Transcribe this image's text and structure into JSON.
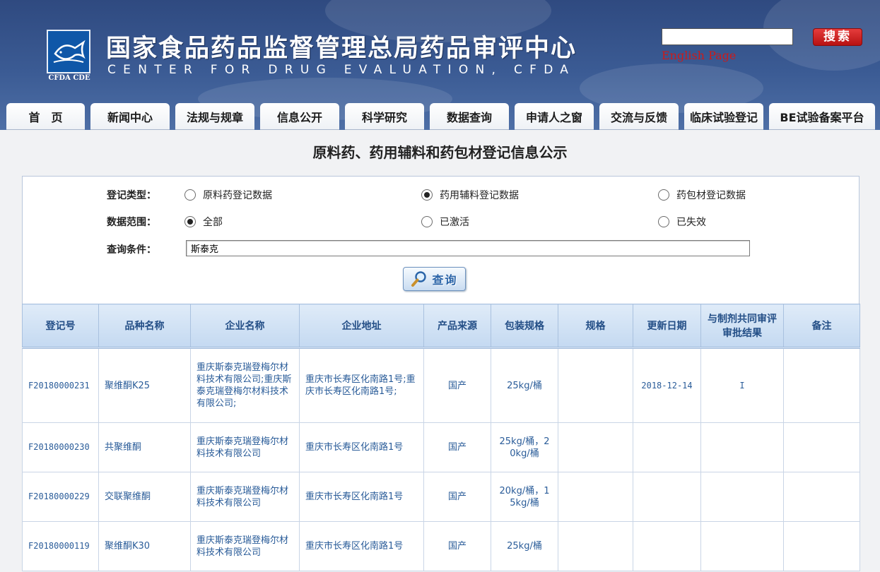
{
  "header": {
    "logo_caption": "CFDA CDE",
    "title": "国家食品药品监督管理总局药品审评中心",
    "subtitle": "CENTER FOR DRUG EVALUATION, CFDA",
    "search_value": "",
    "search_button": "搜索",
    "english_link": "English Page"
  },
  "nav": {
    "tabs": [
      {
        "label": "首　页"
      },
      {
        "label": "新闻中心"
      },
      {
        "label": "法规与规章"
      },
      {
        "label": "信息公开"
      },
      {
        "label": "科学研究"
      },
      {
        "label": "数据查询"
      },
      {
        "label": "申请人之窗"
      },
      {
        "label": "交流与反馈"
      },
      {
        "label": "临床试验登记"
      },
      {
        "label": "BE试验备案平台"
      }
    ]
  },
  "page": {
    "title": "原料药、药用辅料和药包材登记信息公示"
  },
  "form": {
    "type_label": "登记类型：",
    "type_options": [
      {
        "label": "原料药登记数据",
        "selected": false
      },
      {
        "label": "药用辅料登记数据",
        "selected": true
      },
      {
        "label": "药包材登记数据",
        "selected": false
      }
    ],
    "range_label": "数据范围：",
    "range_options": [
      {
        "label": "全部",
        "selected": true
      },
      {
        "label": "已激活",
        "selected": false
      },
      {
        "label": "已失效",
        "selected": false
      }
    ],
    "query_label": "查询条件：",
    "query_value": "斯泰克",
    "query_button": "查询"
  },
  "table": {
    "headers": {
      "reg_no": "登记号",
      "variety": "品种名称",
      "company": "企业名称",
      "address": "企业地址",
      "source": "产品来源",
      "package": "包装规格",
      "spec": "规格",
      "updated": "更新日期",
      "review": "与制剂共同审评审批结果",
      "remark": "备注"
    },
    "rows": [
      {
        "reg_no": "F20180000231",
        "variety": "聚维酮K25",
        "company": "重庆斯泰克瑞登梅尔材料技术有限公司;重庆斯泰克瑞登梅尔材料技术有限公司;",
        "address": "重庆市长寿区化南路1号;重庆市长寿区化南路1号;",
        "source": "国产",
        "package": "25kg/桶",
        "spec": "",
        "updated": "2018-12-14",
        "review": "I",
        "remark": ""
      },
      {
        "reg_no": "F20180000230",
        "variety": "共聚维酮",
        "company": "重庆斯泰克瑞登梅尔材料技术有限公司",
        "address": "重庆市长寿区化南路1号",
        "source": "国产",
        "package": "25kg/桶，20kg/桶",
        "spec": "",
        "updated": "",
        "review": "",
        "remark": ""
      },
      {
        "reg_no": "F20180000229",
        "variety": "交联聚维酮",
        "company": "重庆斯泰克瑞登梅尔材料技术有限公司",
        "address": "重庆市长寿区化南路1号",
        "source": "国产",
        "package": "20kg/桶，15kg/桶",
        "spec": "",
        "updated": "",
        "review": "",
        "remark": ""
      },
      {
        "reg_no": "F20180000119",
        "variety": "聚维酮K30",
        "company": "重庆斯泰克瑞登梅尔材料技术有限公司",
        "address": "重庆市长寿区化南路1号",
        "source": "国产",
        "package": "25kg/桶",
        "spec": "",
        "updated": "",
        "review": "",
        "remark": ""
      }
    ]
  },
  "colors": {
    "header_blue": "#3b5b94",
    "link_blue": "#2a5c99",
    "search_red": "#cc1a1a"
  }
}
